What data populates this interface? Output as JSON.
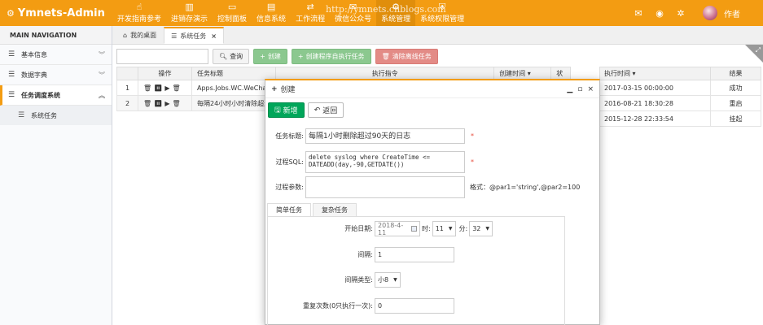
{
  "app": {
    "title": "Ymnets-Admin"
  },
  "watermark": "http://ymnets.cnblogs.com",
  "topnav": [
    {
      "label": "开发指南参考",
      "icon": "pointer-icon"
    },
    {
      "label": "进销存演示",
      "icon": "bank-icon"
    },
    {
      "label": "控制面板",
      "icon": "monitor-icon"
    },
    {
      "label": "信息系统",
      "icon": "info-icon"
    },
    {
      "label": "工作流程",
      "icon": "flow-icon"
    },
    {
      "label": "微信公众号",
      "icon": "wechat-icon"
    },
    {
      "label": "系统管理",
      "icon": "gear-icon"
    },
    {
      "label": "系统权限管理",
      "icon": "shield-icon"
    }
  ],
  "user": {
    "name": "作者"
  },
  "sidebar": {
    "header": "MAIN NAVIGATION",
    "items": [
      {
        "label": "基本信息"
      },
      {
        "label": "数据字典"
      },
      {
        "label": "任务调度系统"
      }
    ],
    "sub": {
      "label": "系统任务"
    }
  },
  "tabs": [
    {
      "label": "我的桌面"
    },
    {
      "label": "系统任务"
    }
  ],
  "toolbar": {
    "query": "查询",
    "create": "创建",
    "create_proc": "创建程序自执行任务",
    "clear": "清除离线任务"
  },
  "grid": {
    "headers": [
      "操作",
      "任务标题",
      "执行指令",
      "创建时间",
      "状"
    ],
    "rows": [
      {
        "no": "1",
        "title": "Apps.Jobs.WC.WeChat"
      },
      {
        "no": "2",
        "title": "每隔24小时小时清除超过"
      }
    ],
    "right_headers": [
      "执行时间",
      "结果"
    ],
    "right_rows": [
      {
        "time": "2017-03-15 00:00:00",
        "result": "成功"
      },
      {
        "time": "2016-08-21 18:30:28",
        "result": "重启"
      },
      {
        "time": "2015-12-28 22:33:54",
        "result": "挂起"
      }
    ]
  },
  "dialog": {
    "title": "创建",
    "save": "新增",
    "back": "返回",
    "fields": {
      "title_label": "任务标题:",
      "title_value": "每隔1小时删除超过90天的日志",
      "sql_label": "过程SQL:",
      "sql_value": "delete syslog where CreateTime <= DATEADD(day,-90,GETDATE())",
      "param_label": "过程参数:",
      "param_hint": "格式：@par1='string',@par2=100"
    },
    "subtabs": [
      "简单任务",
      "复杂任务"
    ],
    "simple": {
      "start_label": "开始日期:",
      "start_date": "2018-4-11",
      "hour_label": "时:",
      "hour": "11",
      "min_label": "分:",
      "minute": "32",
      "interval_label": "间隔:",
      "interval": "1",
      "interval_type_label": "间隔类型:",
      "interval_type": "小8",
      "repeat_label": "重复次数(0只执行一次):",
      "repeat": "0"
    }
  }
}
